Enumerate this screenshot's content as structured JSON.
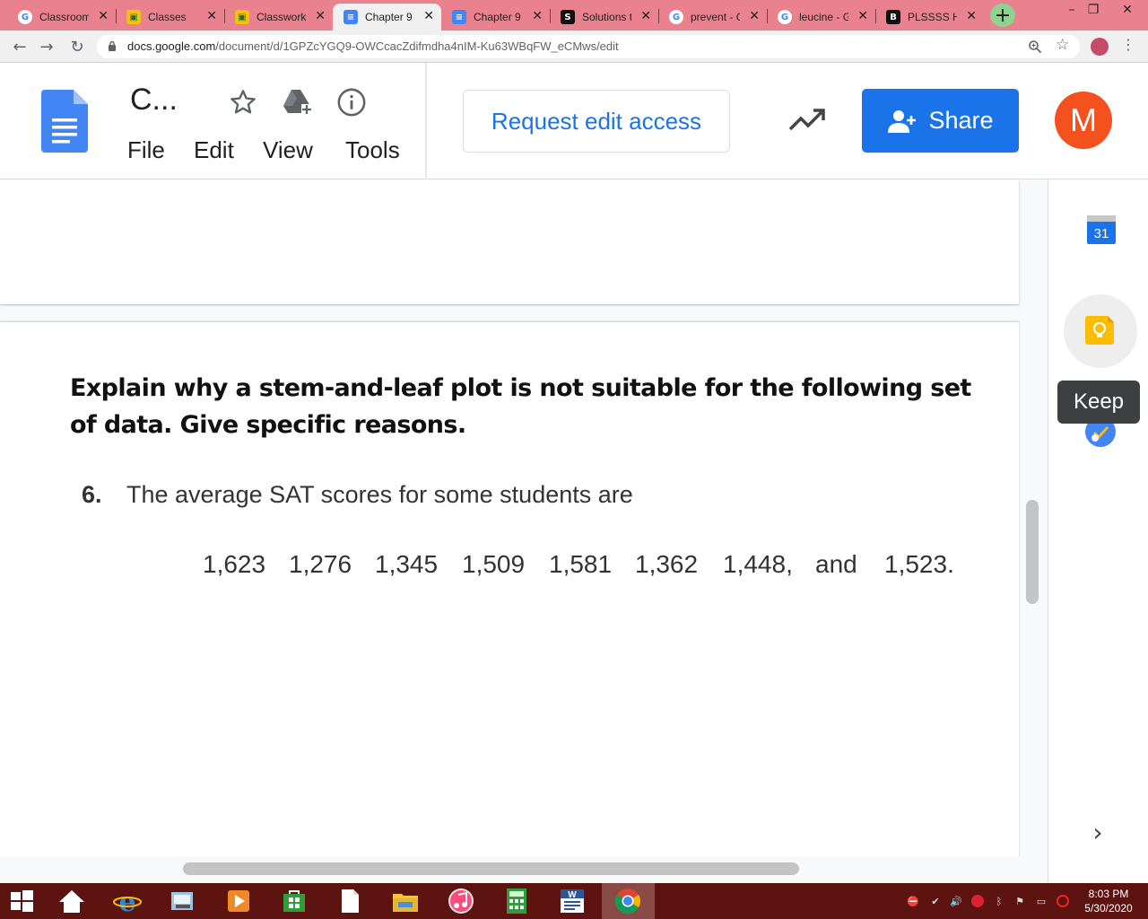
{
  "browser": {
    "tabs": [
      {
        "title": "Classroom",
        "icon": "google-g-icon"
      },
      {
        "title": "Classes",
        "icon": "classroom-icon"
      },
      {
        "title": "Classwork",
        "icon": "classroom-icon"
      },
      {
        "title": "Chapter 9",
        "icon": "docs-icon",
        "active": true
      },
      {
        "title": "Chapter 9",
        "icon": "docs-icon"
      },
      {
        "title": "Solutions t",
        "icon": "slader-icon"
      },
      {
        "title": "prevent - G",
        "icon": "google-g-icon"
      },
      {
        "title": "leucine - G",
        "icon": "google-g-icon"
      },
      {
        "title": "PLSSSS HE",
        "icon": "brainly-icon"
      }
    ],
    "new_tab_label": "+",
    "url_host": "docs.google.com",
    "url_path": "/document/d/1GPZcYGQ9-OWCcacZdifmdha4nIM-Ku63WBqFW_eCMws/edit"
  },
  "docs": {
    "title": "C...",
    "menu": [
      "File",
      "Edit",
      "View",
      "Tools"
    ],
    "request_access_label": "Request edit access",
    "share_label": "Share",
    "avatar_letter": "M",
    "colors": {
      "share": "#1a73e8",
      "avatar": "#f4511e",
      "link": "#1a73e8"
    }
  },
  "content": {
    "heading": "Explain why a stem-and-leaf plot is not suitable for the following set of data. Give specific reasons.",
    "question_number": "6.",
    "question_text": "The average SAT scores for some students are",
    "scores": [
      "1,623",
      "1,276",
      "1,345",
      "1,509",
      "1,581",
      "1,362",
      "1,448,",
      "and",
      "1,523."
    ]
  },
  "side_panel": {
    "calendar_day": "31",
    "tooltip": "Keep"
  },
  "taskbar": {
    "time": "8:03 PM",
    "date": "5/30/2020"
  }
}
